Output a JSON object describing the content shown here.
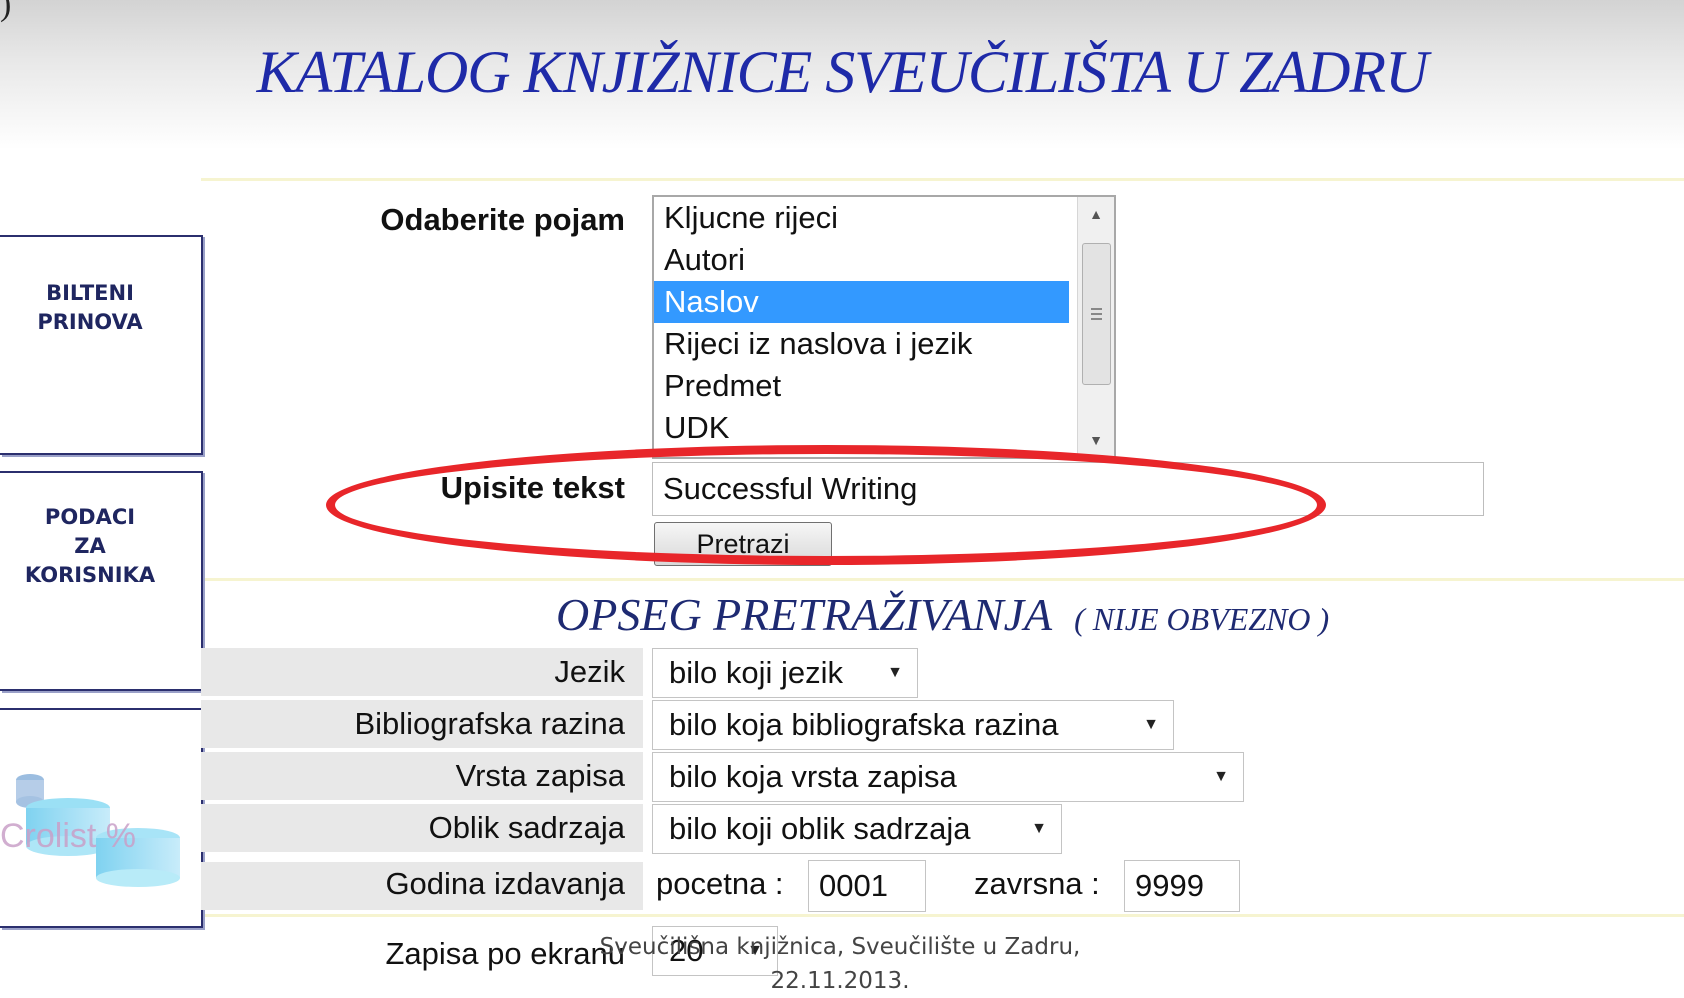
{
  "header": {
    "corner_mark": ")",
    "title": "KATALOG KNJIŽNICE SVEUČILIŠTA U ZADRU"
  },
  "sidebar": {
    "bilteni": [
      "BILTENI",
      "PRINOVA"
    ],
    "podaci": [
      "PODACI",
      "ZA",
      "KORISNIKA"
    ],
    "logo_text": "Crolist %"
  },
  "form": {
    "term_label": "Odaberite pojam",
    "term_options": [
      "Kljucne rijeci",
      "Autori",
      "Naslov",
      "Rijeci iz naslova i jezik",
      "Predmet",
      "UDK"
    ],
    "term_selected": "Naslov",
    "text_label": "Upisite tekst",
    "text_value": "Successful Writing",
    "search_button": "Pretrazi"
  },
  "scope": {
    "title": "OPSEG PRETRAŽIVANJA",
    "note": "( NIJE OBVEZNO )",
    "language_label": "Jezik",
    "language_value": "bilo koji jezik",
    "biblevel_label": "Bibliografska razina",
    "biblevel_value": "bilo koja bibliografska razina",
    "rectype_label": "Vrsta zapisa",
    "rectype_value": "bilo koja vrsta zapisa",
    "content_label": "Oblik sadrzaja",
    "content_value": "bilo koji oblik sadrzaja",
    "year_label": "Godina izdavanja",
    "year_from_label": "pocetna :",
    "year_from": "0001",
    "year_to_label": "zavrsna :",
    "year_to": "9999",
    "perpage_label": "Zapisa po ekranu",
    "perpage_value": "20"
  },
  "footer": {
    "line1": "Sveučilišna knjižnica, Sveučilište u Zadru,",
    "line2": "22.11.2013."
  },
  "colors": {
    "title": "#1e2aa8",
    "selection": "#3399ff",
    "annotation": "#e8262a"
  }
}
